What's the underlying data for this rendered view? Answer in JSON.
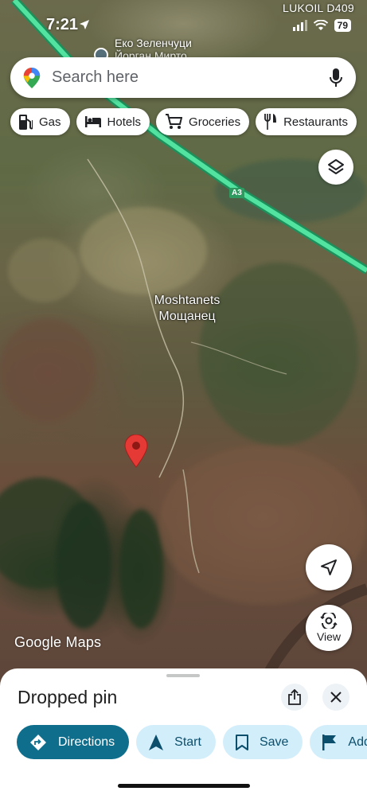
{
  "status_bar": {
    "time": "7:21",
    "battery": "79",
    "network_label": "LUKOIL D409"
  },
  "map": {
    "top_place": "Еко Зеленчуци",
    "top_place_sub": "Йорган Мирто",
    "village_name_latin": "Moshtanets",
    "village_name_cyrillic": "Мощанец",
    "road_label": "A3",
    "watermark": "Google Maps"
  },
  "search": {
    "placeholder": "Search here"
  },
  "chips": [
    {
      "label": "Gas",
      "icon": "gas-station-icon"
    },
    {
      "label": "Hotels",
      "icon": "bed-icon"
    },
    {
      "label": "Groceries",
      "icon": "shopping-cart-icon"
    },
    {
      "label": "Restaurants",
      "icon": "fork-knife-icon"
    }
  ],
  "view_button": {
    "label": "View"
  },
  "sheet": {
    "title": "Dropped pin",
    "actions": [
      {
        "label": "Directions",
        "icon": "directions-icon"
      },
      {
        "label": "Start",
        "icon": "navigation-arrow-icon"
      },
      {
        "label": "Save",
        "icon": "bookmark-icon"
      },
      {
        "label": "Add",
        "icon": "flag-icon"
      }
    ]
  },
  "colors": {
    "pin_red": "#e53935",
    "primary_action": "#0e6e8c",
    "secondary_action": "#d3eefb",
    "highway_green": "#3ddc84"
  }
}
